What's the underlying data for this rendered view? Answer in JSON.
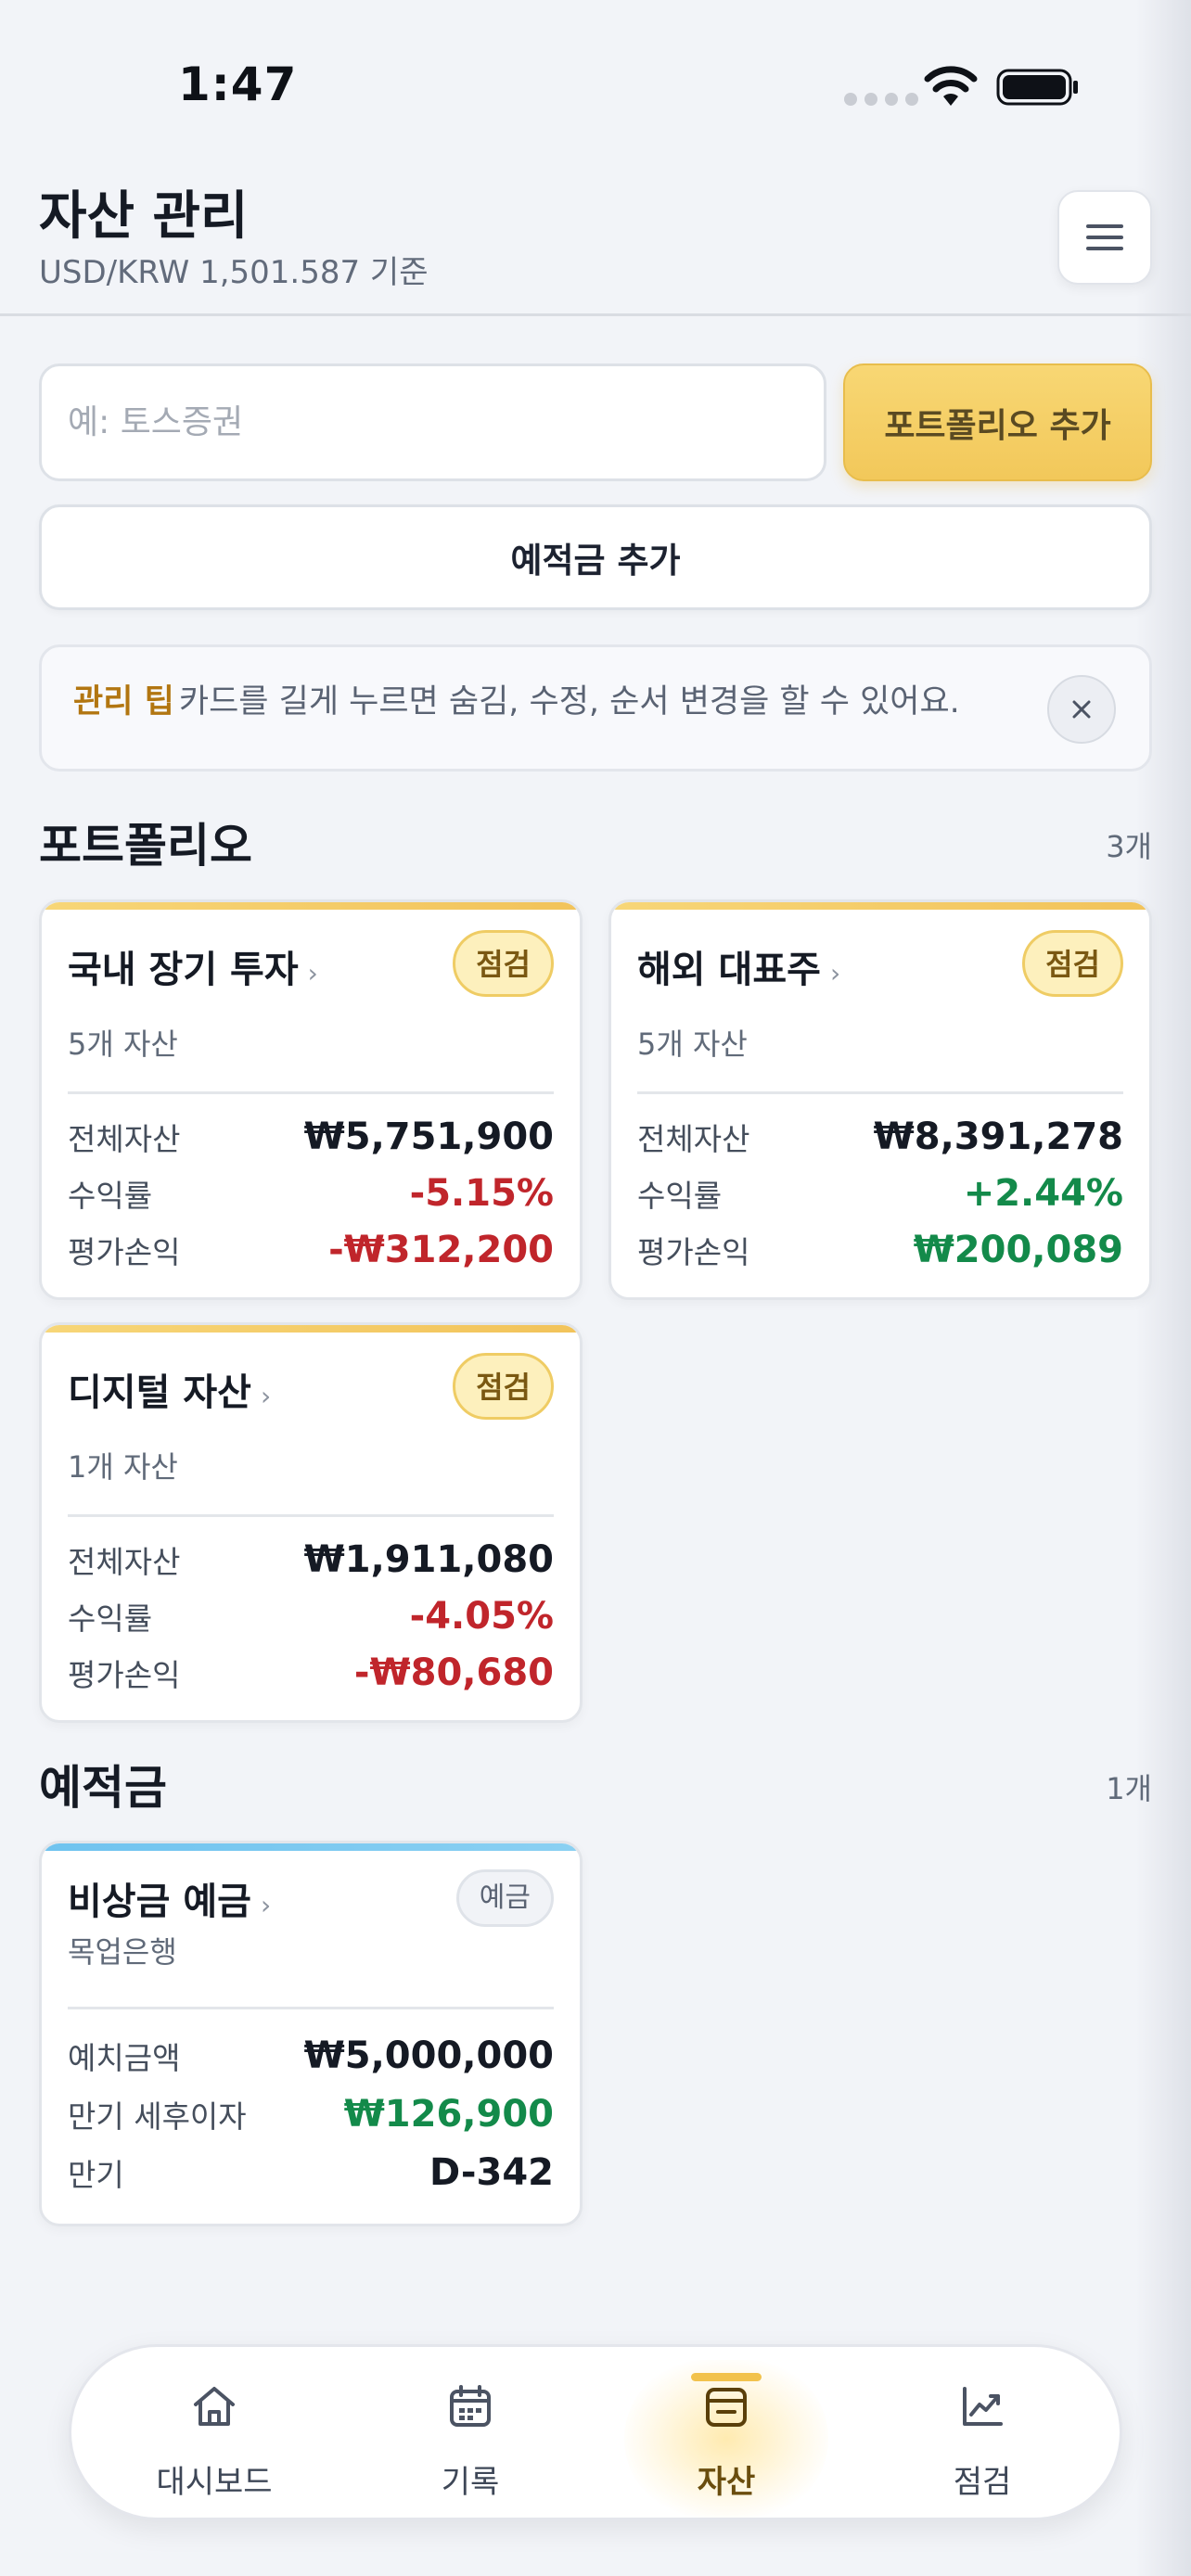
{
  "status_bar": {
    "time": "1:47"
  },
  "header": {
    "title": "자산 관리",
    "subtitle": "USD/KRW 1,501.587 기준"
  },
  "form": {
    "input_placeholder": "예: 토스증권",
    "add_portfolio_label": "포트폴리오 추가",
    "add_deposit_label": "예적금 추가"
  },
  "tip": {
    "label": "관리 팁",
    "text": "카드를 길게 누르면 숨김, 수정, 순서 변경을 할 수 있어요."
  },
  "portfolio_section": {
    "title": "포트폴리오",
    "count": "3개",
    "cards": [
      {
        "title": "국내 장기 투자",
        "badge": "점검",
        "asset_count": "5개 자산",
        "rows": [
          {
            "label": "전체자산",
            "value": "₩5,751,900"
          },
          {
            "label": "수익률",
            "value": "-5.15%"
          },
          {
            "label": "평가손익",
            "value": "-₩312,200"
          }
        ]
      },
      {
        "title": "해외 대표주",
        "badge": "점검",
        "asset_count": "5개 자산",
        "rows": [
          {
            "label": "전체자산",
            "value": "₩8,391,278"
          },
          {
            "label": "수익률",
            "value": "+2.44%"
          },
          {
            "label": "평가손익",
            "value": "₩200,089"
          }
        ]
      },
      {
        "title": "디지털 자산",
        "badge": "점검",
        "asset_count": "1개 자산",
        "rows": [
          {
            "label": "전체자산",
            "value": "₩1,911,080"
          },
          {
            "label": "수익률",
            "value": "-4.05%"
          },
          {
            "label": "평가손익",
            "value": "-₩80,680"
          }
        ]
      }
    ]
  },
  "deposit_section": {
    "title": "예적금",
    "count": "1개",
    "cards": [
      {
        "title": "비상금 예금",
        "badge": "예금",
        "bank": "목업은행",
        "rows": [
          {
            "label": "예치금액",
            "value": "₩5,000,000"
          },
          {
            "label": "만기 세후이자",
            "value": "₩126,900"
          },
          {
            "label": "만기",
            "value": "D-342"
          }
        ]
      }
    ]
  },
  "nav": {
    "items": [
      {
        "label": "대시보드",
        "icon": "home-icon"
      },
      {
        "label": "기록",
        "icon": "calendar-icon"
      },
      {
        "label": "자산",
        "icon": "wallet-icon"
      },
      {
        "label": "점검",
        "icon": "chart-icon"
      }
    ],
    "active": "자산"
  },
  "colors": {
    "accent_gold": "#f2c85a",
    "negative": "#c0252b",
    "positive": "#138a4a",
    "deposit_accent": "#6fc3ef"
  }
}
